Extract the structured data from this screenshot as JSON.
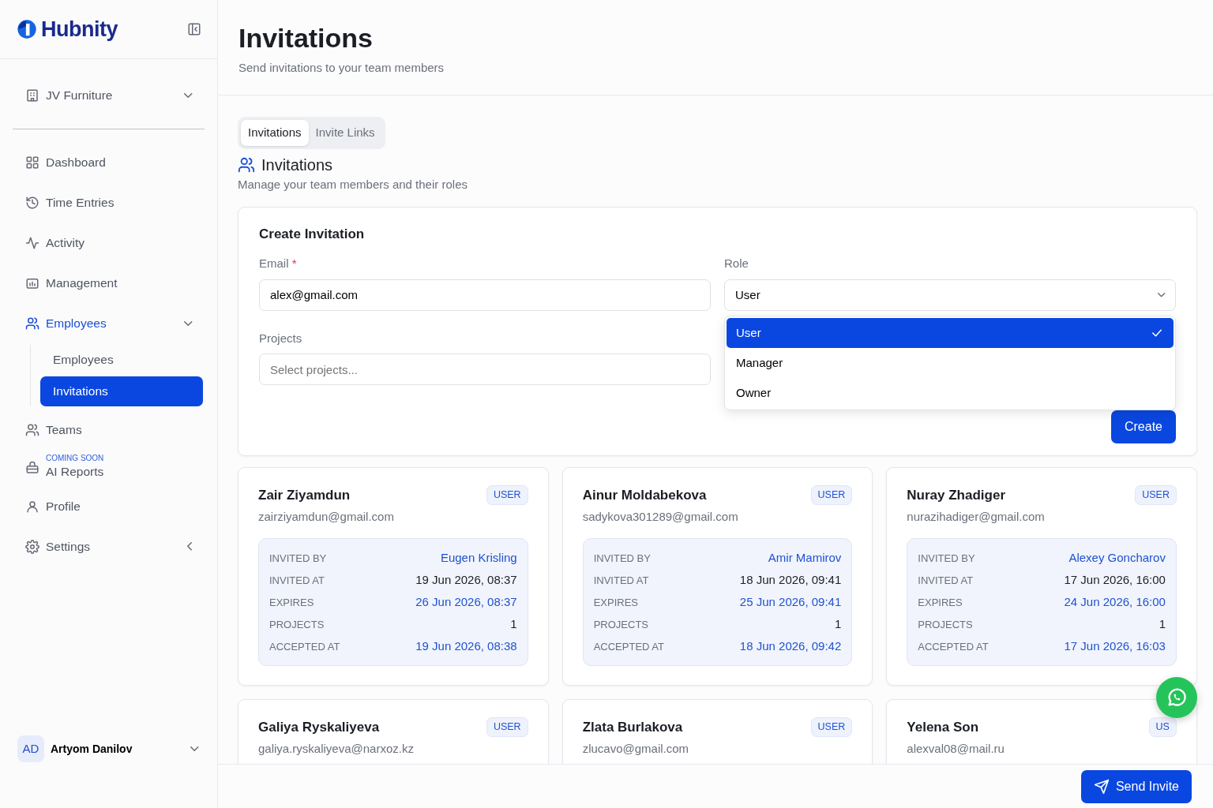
{
  "sidebar": {
    "brand": "Hubnity",
    "workspace": "JV Furniture",
    "items": [
      {
        "label": "Dashboard",
        "selected": false
      },
      {
        "label": "Time Entries",
        "selected": false
      },
      {
        "label": "Activity",
        "selected": false
      },
      {
        "label": "Management",
        "selected": false
      },
      {
        "label": "Employees",
        "selected": true,
        "expanded": true,
        "children": [
          {
            "label": "Employees",
            "selected": false
          },
          {
            "label": "Invitations",
            "selected": true
          }
        ]
      },
      {
        "label": "Teams",
        "selected": false
      },
      {
        "label": "AI Reports",
        "selected": false,
        "badge": "COMING SOON"
      },
      {
        "label": "Profile",
        "selected": false
      },
      {
        "label": "Settings",
        "selected": false,
        "expanded": false
      }
    ],
    "user": {
      "initials": "AD",
      "name": "Artyom Danilov"
    }
  },
  "header": {
    "title": "Invitations",
    "subtitle": "Send invitations to your team members"
  },
  "tabs": [
    {
      "label": "Invitations",
      "selected": true
    },
    {
      "label": "Invite Links",
      "selected": false
    }
  ],
  "section": {
    "title": "Invitations",
    "subtitle": "Manage your team members and their roles"
  },
  "form": {
    "title": "Create Invitation",
    "email_label": "Email",
    "required_mark": "*",
    "email_value": "alex@gmail.com",
    "role_label": "Role",
    "role_value": "User",
    "projects_label": "Projects",
    "projects_placeholder": "Select projects...",
    "role_options": [
      {
        "label": "User",
        "selected": true
      },
      {
        "label": "Manager",
        "selected": false
      },
      {
        "label": "Owner",
        "selected": false
      }
    ],
    "submit": "Create"
  },
  "invitations": [
    {
      "name": "Zair Ziyamdun",
      "email": "zairziyamdun@gmail.com",
      "role": "USER",
      "details": [
        {
          "label": "INVITED BY",
          "value": "Eugen Krisling",
          "accent": true
        },
        {
          "label": "INVITED AT",
          "value": "19 Jun 2026, 08:37",
          "accent": false
        },
        {
          "label": "EXPIRES",
          "value": "26 Jun 2026, 08:37",
          "accent": true
        },
        {
          "label": "PROJECTS",
          "value": "1",
          "accent": false
        },
        {
          "label": "ACCEPTED AT",
          "value": "19 Jun 2026, 08:38",
          "accent": true
        }
      ]
    },
    {
      "name": "Ainur Moldabekova",
      "email": "sadykova301289@gmail.com",
      "role": "USER",
      "details": [
        {
          "label": "INVITED BY",
          "value": "Amir Mamirov",
          "accent": true
        },
        {
          "label": "INVITED AT",
          "value": "18 Jun 2026, 09:41",
          "accent": false
        },
        {
          "label": "EXPIRES",
          "value": "25 Jun 2026, 09:41",
          "accent": true
        },
        {
          "label": "PROJECTS",
          "value": "1",
          "accent": false
        },
        {
          "label": "ACCEPTED AT",
          "value": "18 Jun 2026, 09:42",
          "accent": true
        }
      ]
    },
    {
      "name": "Nuray Zhadiger",
      "email": "nurazihadiger@gmail.com",
      "role": "USER",
      "details": [
        {
          "label": "INVITED BY",
          "value": "Alexey Goncharov",
          "accent": true
        },
        {
          "label": "INVITED AT",
          "value": "17 Jun 2026, 16:00",
          "accent": false
        },
        {
          "label": "EXPIRES",
          "value": "24 Jun 2026, 16:00",
          "accent": true
        },
        {
          "label": "PROJECTS",
          "value": "1",
          "accent": false
        },
        {
          "label": "ACCEPTED AT",
          "value": "17 Jun 2026, 16:03",
          "accent": true
        }
      ]
    },
    {
      "name": "Galiya Ryskaliyeva",
      "email": "galiya.ryskaliyeva@narxoz.kz",
      "role": "USER"
    },
    {
      "name": "Zlata Burlakova",
      "email": "zlucavo@gmail.com",
      "role": "USER"
    },
    {
      "name": "Yelena Son",
      "email": "alexval08@mail.ru",
      "role": "US"
    }
  ],
  "send_button": "Send Invite"
}
